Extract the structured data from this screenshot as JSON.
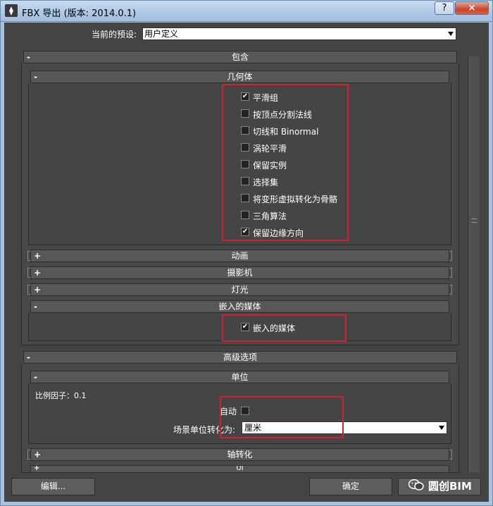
{
  "window": {
    "title": "FBX 导出 (版本: 2014.0.1)",
    "help_label": "?",
    "close_label": "×"
  },
  "preset": {
    "label": "当前的预设:",
    "value": "用户定义"
  },
  "sections": {
    "include": {
      "title": "包含",
      "sign": "-"
    },
    "geometry": {
      "title": "几何体",
      "sign": "-",
      "options": [
        {
          "label": "平滑组",
          "checked": true
        },
        {
          "label": "按顶点分割法线",
          "checked": false
        },
        {
          "label": "切线和 Binormal",
          "checked": false
        },
        {
          "label": "涡轮平滑",
          "checked": false
        },
        {
          "label": "保留实例",
          "checked": false
        },
        {
          "label": "选择集",
          "checked": false
        },
        {
          "label": "将变形虚拟转化为骨骼",
          "checked": false
        },
        {
          "label": "三角算法",
          "checked": false
        },
        {
          "label": "保留边缘方向",
          "checked": true
        }
      ]
    },
    "animation": {
      "title": "动画",
      "sign": "+"
    },
    "camera": {
      "title": "摄影机",
      "sign": "+"
    },
    "light": {
      "title": "灯光",
      "sign": "+"
    },
    "embed_media": {
      "title": "嵌入的媒体",
      "sign": "-",
      "option": {
        "label": "嵌入的媒体",
        "checked": true
      }
    },
    "advanced": {
      "title": "高级选项",
      "sign": "-"
    },
    "units": {
      "title": "单位",
      "sign": "-",
      "scale_factor": "比例因子：0.1",
      "auto_label": "自动",
      "auto_checked": false,
      "convert_label": "场景单位转化为:",
      "convert_value": "厘米"
    },
    "axis": {
      "title": "轴转化",
      "sign": "+"
    },
    "ui": {
      "title": "UI",
      "sign": "+"
    }
  },
  "buttons": {
    "edit": "编辑...",
    "ok": "确定"
  },
  "watermark": {
    "text": "圆创BIM"
  },
  "colors": {
    "panel_bg": "#444444",
    "highlight_box": "#d1202f",
    "titlebar": "#aec8e4"
  }
}
